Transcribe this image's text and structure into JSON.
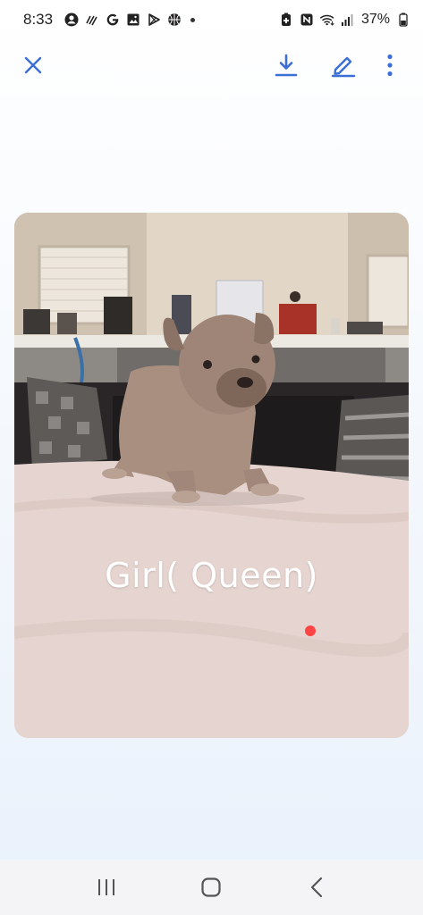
{
  "status_bar": {
    "time": "8:33",
    "battery_percent": "37%",
    "left_icons": [
      "account-circle-icon",
      "stylus-icon",
      "google-g-icon",
      "gallery-icon",
      "play-store-icon",
      "basketball-icon",
      "notification-dot-icon"
    ],
    "right_icons": [
      "battery-saver-icon",
      "nfc-icon",
      "wifi-icon",
      "signal-icon",
      "battery-icon"
    ]
  },
  "toolbar": {
    "icons": [
      "close-icon",
      "download-icon",
      "edit-pencil-icon",
      "more-vert-icon"
    ],
    "accent_color": "#3b6fd6"
  },
  "image": {
    "caption": "Girl( Queen)",
    "subject": "puppy-photo"
  },
  "nav_bar": {
    "icons": [
      "recent-apps-icon",
      "home-icon",
      "back-icon"
    ]
  }
}
